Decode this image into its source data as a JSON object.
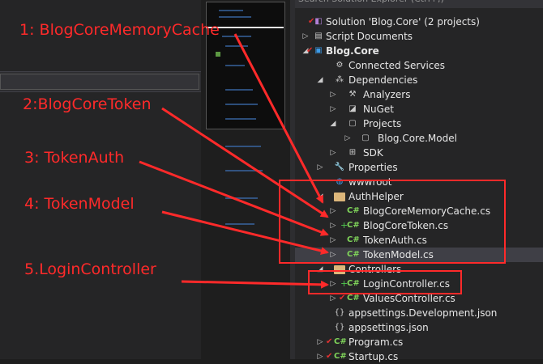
{
  "explorer": {
    "search_placeholder": "Search Solution Explorer (Ctrl+;)",
    "items": [
      {
        "label": "Solution 'Blog.Core' (2 projects)",
        "icon": "solution-icon",
        "check": true
      },
      {
        "label": "Script Documents",
        "icon": "script-documents-icon"
      },
      {
        "label": "Blog.Core",
        "icon": "csharp-project-icon",
        "check": true,
        "bold": true
      },
      {
        "label": "Connected Services",
        "icon": "connected-services-icon"
      },
      {
        "label": "Dependencies",
        "icon": "dependencies-icon"
      },
      {
        "label": "Analyzers",
        "icon": "analyzers-icon"
      },
      {
        "label": "NuGet",
        "icon": "nuget-icon"
      },
      {
        "label": "Projects",
        "icon": "projects-icon"
      },
      {
        "label": "Blog.Core.Model",
        "icon": "project-reference-icon"
      },
      {
        "label": "SDK",
        "icon": "sdk-icon"
      },
      {
        "label": "Properties",
        "icon": "wrench-icon"
      },
      {
        "label": "wwwroot",
        "icon": "globe-icon"
      },
      {
        "label": "AuthHelper",
        "icon": "folder-open-icon"
      },
      {
        "label": "BlogCoreMemoryCache.cs",
        "icon": "csharp-file-icon"
      },
      {
        "label": "BlogCoreToken.cs",
        "icon": "csharp-file-icon",
        "plus": true
      },
      {
        "label": "TokenAuth.cs",
        "icon": "csharp-file-icon"
      },
      {
        "label": "TokenModel.cs",
        "icon": "csharp-file-icon"
      },
      {
        "label": "Controllers",
        "icon": "folder-open-icon"
      },
      {
        "label": "LoginController.cs",
        "icon": "csharp-file-icon",
        "plus": true
      },
      {
        "label": "ValuesController.cs",
        "icon": "csharp-file-icon",
        "check": true
      },
      {
        "label": "appsettings.Development.json",
        "icon": "json-file-icon"
      },
      {
        "label": "appsettings.json",
        "icon": "json-file-icon"
      },
      {
        "label": "Program.cs",
        "icon": "csharp-file-icon",
        "check": true
      },
      {
        "label": "Startup.cs",
        "icon": "csharp-file-icon",
        "check": true
      }
    ]
  },
  "annotations": {
    "a1": "1:  BlogCoreMemoryCache",
    "a2": "2:BlogCoreToken",
    "a3": "3: TokenAuth",
    "a4": "4: TokenModel",
    "a5": "5.LoginController"
  },
  "colors": {
    "annotation": "#ff2a2a",
    "background": "#252526"
  }
}
